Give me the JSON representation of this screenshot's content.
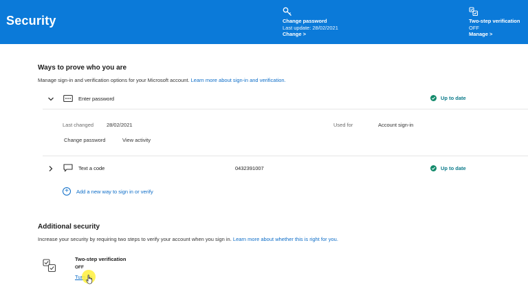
{
  "header": {
    "title": "Security",
    "change_password": {
      "title": "Change password",
      "subtitle": "Last update: 28/02/2021",
      "link": "Change >"
    },
    "two_step": {
      "title": "Two-step verification",
      "status": "OFF",
      "link": "Manage >"
    }
  },
  "ways": {
    "title": "Ways to prove who you are",
    "description": "Manage sign-in and verification options for your Microsoft account.",
    "learn_more": "Learn more about sign-in and verification.",
    "methods": [
      {
        "label": "Enter password",
        "status": "Up to date",
        "details": {
          "last_changed_label": "Last changed",
          "last_changed_value": "28/02/2021",
          "used_for_label": "Used for",
          "used_for_value": "Account sign-in",
          "action_change": "Change password",
          "action_view": "View activity"
        }
      },
      {
        "label": "Text a code",
        "value": "0432391007",
        "status": "Up to date"
      }
    ],
    "add_way": "Add a new way to sign in or verify"
  },
  "additional": {
    "title": "Additional security",
    "description": "Increase your security by requiring two steps to verify your account when you sign in.",
    "learn_more": "Learn more about whether this is right for you.",
    "two_step": {
      "title": "Two-step verification",
      "status": "OFF",
      "link": "Turn on"
    }
  },
  "colors": {
    "header_bg": "#0b7ad9",
    "link": "#0b6cc7",
    "status_text": "#0b7a8a",
    "status_dot": "#138a6b"
  },
  "icons": {
    "change_password": "key-icon",
    "two_step_header": "two-step-icon",
    "password_method": "password-dots-icon",
    "text_method": "chat-bubble-icon",
    "status": "check-circle-icon",
    "add": "plus-circle-icon",
    "two_step_section": "two-step-checklist-icon",
    "cursor": "hand-pointer-icon"
  }
}
